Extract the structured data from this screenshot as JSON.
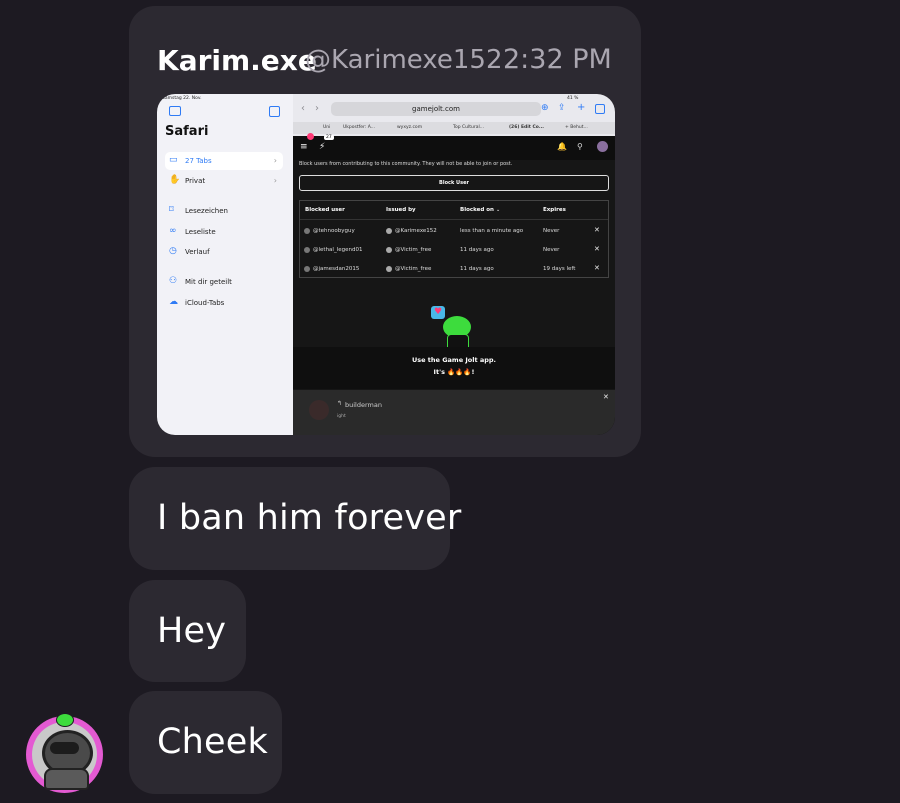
{
  "message": {
    "author": "Karim.exe",
    "handle": "@Karimexe152",
    "time": "2:32 PM",
    "texts": [
      "I ban him forever",
      "Hey",
      "Cheek"
    ]
  },
  "screenshot": {
    "status_left": "Samstag 22. Nov.",
    "status_right": "41 %",
    "address": "gamejolt.com",
    "tabs": [
      "Uni",
      "Ukpostfer: A...",
      "wyxyz.com",
      "Top Cultural...",
      "(26) Edit Co...",
      "+ Behut..."
    ],
    "sidebar": {
      "title": "Safari",
      "items": [
        {
          "label": "27 Tabs",
          "icon": "tabs-icon"
        },
        {
          "label": "Privat",
          "icon": "hand-icon"
        },
        {
          "label": "Lesezeichen",
          "icon": "bookmark-icon"
        },
        {
          "label": "Leseliste",
          "icon": "glasses-icon"
        },
        {
          "label": "Verlauf",
          "icon": "clock-icon"
        },
        {
          "label": "Mit dir geteilt",
          "icon": "shared-icon"
        },
        {
          "label": "iCloud-Tabs",
          "icon": "cloud-icon"
        }
      ]
    },
    "notice": "Block users from contributing to this community. They will not be able to join or post.",
    "badge": "27",
    "block_button": "Block User",
    "table": {
      "headers": [
        "Blocked user",
        "Issued by",
        "Blocked on",
        "Expires"
      ],
      "rows": [
        [
          "@tehnoobyguy",
          "@Karimexe152",
          "less than a minute ago",
          "Never"
        ],
        [
          "@lethal_legend01",
          "@Victim_free",
          "11 days ago",
          "Never"
        ],
        [
          "@jamesdan2015",
          "@Victim_free",
          "11 days ago",
          "19 days left"
        ]
      ]
    },
    "promo": {
      "line1": "Use the Game Jolt app.",
      "line2": "It's 🔥🔥🔥!"
    },
    "comment": {
      "user": "builderman",
      "text": "ight"
    },
    "colors": {
      "sidebar_accent": "#2f7bf5",
      "gj_pink": "#ff3a76",
      "frog_green": "#3ddc3d"
    }
  }
}
